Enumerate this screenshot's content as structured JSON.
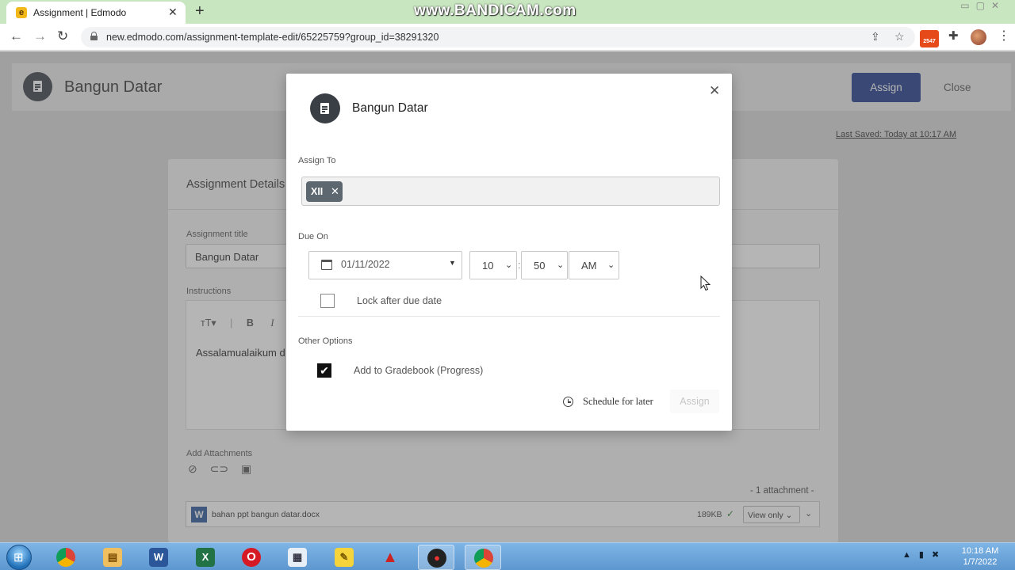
{
  "browser": {
    "tab_title": "Assignment | Edmodo",
    "tab_favicon": "e",
    "url": "new.edmodo.com/assignment-template-edit/65225759?group_id=38291320",
    "extension_badge": "2547"
  },
  "watermark": "www.BANDICAM.com",
  "page": {
    "title": "Bangun Datar",
    "assign_button": "Assign",
    "close_link": "Close",
    "last_saved": "Last Saved: Today at 10:17 AM",
    "card_title": "Assignment Details",
    "assignment_title_label": "Assignment title",
    "assignment_title_value": "Bangun Datar",
    "instructions_label": "Instructions",
    "instructions_text": "Assalamualaikum d",
    "add_attachments_label": "Add Attachments",
    "attachment_count": "- 1 attachment -",
    "attachment": {
      "name": "bahan ppt bangun datar.docx",
      "size": "189KB",
      "permission": "View only"
    }
  },
  "modal": {
    "title": "Bangun Datar",
    "assign_to_label": "Assign To",
    "assign_to_chip": "XII",
    "due_on_label": "Due On",
    "due_date": "01/11/2022",
    "due_hour": "10",
    "due_minute": "50",
    "due_ampm": "AM",
    "lock_label": "Lock after due date",
    "lock_checked": false,
    "other_options_label": "Other Options",
    "gradebook_label": "Add to Gradebook (Progress)",
    "gradebook_checked": true,
    "schedule_label": "Schedule for later",
    "assign_button": "Assign"
  },
  "taskbar": {
    "time": "10:18 AM",
    "date": "1/7/2022"
  },
  "colors": {
    "tab_strip": "#c8e6c0",
    "primary_button": "#1f3a8a",
    "taskbar": "#5d97cf"
  },
  "icons": [
    "back-arrow-icon",
    "forward-arrow-icon",
    "reload-icon",
    "lock-icon",
    "share-icon",
    "star-icon",
    "puzzle-icon",
    "document-icon",
    "close-icon",
    "calendar-icon",
    "clock-icon",
    "checkmark-icon",
    "paperclip-icon",
    "link-icon",
    "archive-icon"
  ]
}
